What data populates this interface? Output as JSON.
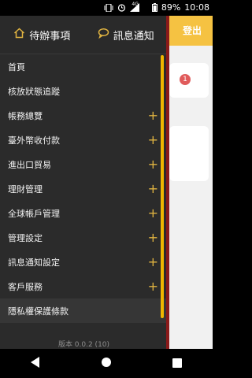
{
  "status": {
    "battery": "89%",
    "time": "10:08",
    "network": "4G"
  },
  "background": {
    "logout_label": "登出",
    "badge": "1"
  },
  "drawer": {
    "pending_label": "待辦事項",
    "messages_label": "訊息通知",
    "items": [
      {
        "label": "首頁",
        "expand": ""
      },
      {
        "label": "核放狀態追蹤",
        "expand": ""
      },
      {
        "label": "帳務總覽",
        "expand": "+"
      },
      {
        "label": "臺外幣收付款",
        "expand": "+"
      },
      {
        "label": "進出口貿易",
        "expand": "+"
      },
      {
        "label": "理財管理",
        "expand": "+"
      },
      {
        "label": "全球帳戶管理",
        "expand": "+"
      },
      {
        "label": "管理設定",
        "expand": "+"
      },
      {
        "label": "訊息通知設定",
        "expand": "+"
      },
      {
        "label": "客戶服務",
        "expand": "+"
      },
      {
        "label": "隱私權保護條款",
        "expand": ""
      }
    ],
    "version": "版本 0.0.2 (10)"
  },
  "colors": {
    "accent": "#e1b441",
    "drawer_bg": "#2b2b2b"
  }
}
